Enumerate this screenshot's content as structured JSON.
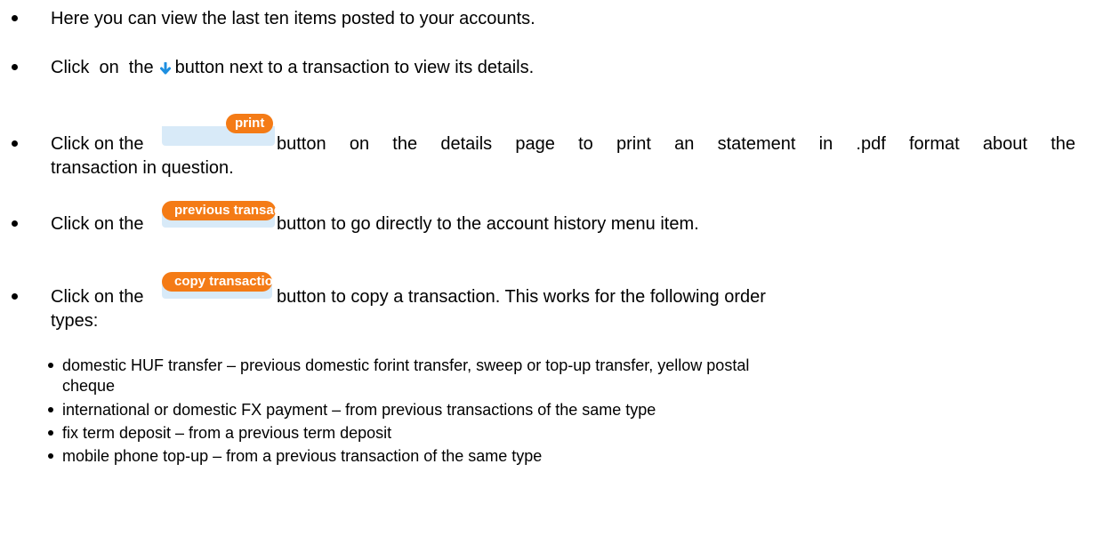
{
  "intro": {
    "text": "Here you can view the last ten items posted to your accounts."
  },
  "details": {
    "before": "Click  on  the",
    "after": "button next to a transaction to view its details."
  },
  "print": {
    "button": "print",
    "line1_before": "Click on the",
    "line1_words": [
      "button",
      "on",
      "the",
      "details",
      "page",
      "to",
      "print",
      "an",
      "statement",
      "in",
      ".pdf",
      "format",
      "about",
      "the"
    ],
    "line2": "transaction in question."
  },
  "previous": {
    "button": "previous transactions",
    "before": "Click on the",
    "after": "button to go directly to the account history menu item."
  },
  "copy": {
    "button": "copy transaction",
    "before": "Click on the",
    "after": "button to copy a transaction. This works for the following order",
    "line2": "types:"
  },
  "order_types": [
    {
      "line1": "domestic HUF transfer – previous domestic forint transfer, sweep or top-up transfer, yellow postal",
      "line2": "cheque"
    },
    {
      "line1": "international or domestic FX payment – from previous transactions of the same type"
    },
    {
      "line1": "fix term deposit – from a previous term deposit"
    },
    {
      "line1": "mobile phone top-up – from a previous transaction of the same type"
    }
  ],
  "colors": {
    "button_bg": "#f47b16",
    "button_text": "#ffffff",
    "arrow_icon": "#1e8fe0",
    "button_shadow_bg": "#d8eaf8"
  }
}
